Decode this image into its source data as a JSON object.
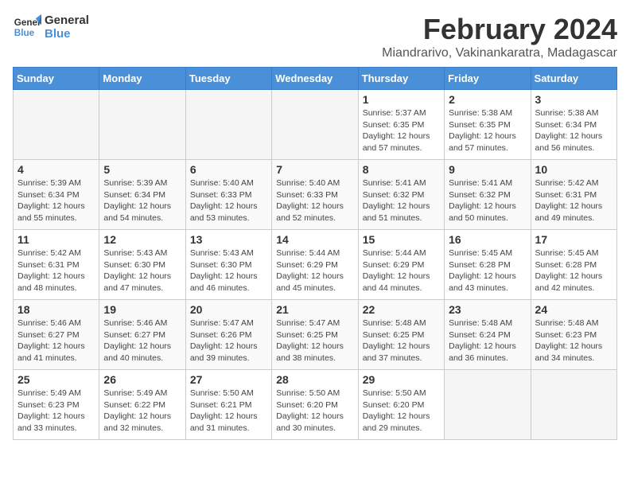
{
  "logo": {
    "line1": "General",
    "line2": "Blue"
  },
  "title": "February 2024",
  "location": "Miandrarivo, Vakinankaratra, Madagascar",
  "days_of_week": [
    "Sunday",
    "Monday",
    "Tuesday",
    "Wednesday",
    "Thursday",
    "Friday",
    "Saturday"
  ],
  "weeks": [
    [
      {
        "day": "",
        "info": ""
      },
      {
        "day": "",
        "info": ""
      },
      {
        "day": "",
        "info": ""
      },
      {
        "day": "",
        "info": ""
      },
      {
        "day": "1",
        "info": "Sunrise: 5:37 AM\nSunset: 6:35 PM\nDaylight: 12 hours\nand 57 minutes."
      },
      {
        "day": "2",
        "info": "Sunrise: 5:38 AM\nSunset: 6:35 PM\nDaylight: 12 hours\nand 57 minutes."
      },
      {
        "day": "3",
        "info": "Sunrise: 5:38 AM\nSunset: 6:34 PM\nDaylight: 12 hours\nand 56 minutes."
      }
    ],
    [
      {
        "day": "4",
        "info": "Sunrise: 5:39 AM\nSunset: 6:34 PM\nDaylight: 12 hours\nand 55 minutes."
      },
      {
        "day": "5",
        "info": "Sunrise: 5:39 AM\nSunset: 6:34 PM\nDaylight: 12 hours\nand 54 minutes."
      },
      {
        "day": "6",
        "info": "Sunrise: 5:40 AM\nSunset: 6:33 PM\nDaylight: 12 hours\nand 53 minutes."
      },
      {
        "day": "7",
        "info": "Sunrise: 5:40 AM\nSunset: 6:33 PM\nDaylight: 12 hours\nand 52 minutes."
      },
      {
        "day": "8",
        "info": "Sunrise: 5:41 AM\nSunset: 6:32 PM\nDaylight: 12 hours\nand 51 minutes."
      },
      {
        "day": "9",
        "info": "Sunrise: 5:41 AM\nSunset: 6:32 PM\nDaylight: 12 hours\nand 50 minutes."
      },
      {
        "day": "10",
        "info": "Sunrise: 5:42 AM\nSunset: 6:31 PM\nDaylight: 12 hours\nand 49 minutes."
      }
    ],
    [
      {
        "day": "11",
        "info": "Sunrise: 5:42 AM\nSunset: 6:31 PM\nDaylight: 12 hours\nand 48 minutes."
      },
      {
        "day": "12",
        "info": "Sunrise: 5:43 AM\nSunset: 6:30 PM\nDaylight: 12 hours\nand 47 minutes."
      },
      {
        "day": "13",
        "info": "Sunrise: 5:43 AM\nSunset: 6:30 PM\nDaylight: 12 hours\nand 46 minutes."
      },
      {
        "day": "14",
        "info": "Sunrise: 5:44 AM\nSunset: 6:29 PM\nDaylight: 12 hours\nand 45 minutes."
      },
      {
        "day": "15",
        "info": "Sunrise: 5:44 AM\nSunset: 6:29 PM\nDaylight: 12 hours\nand 44 minutes."
      },
      {
        "day": "16",
        "info": "Sunrise: 5:45 AM\nSunset: 6:28 PM\nDaylight: 12 hours\nand 43 minutes."
      },
      {
        "day": "17",
        "info": "Sunrise: 5:45 AM\nSunset: 6:28 PM\nDaylight: 12 hours\nand 42 minutes."
      }
    ],
    [
      {
        "day": "18",
        "info": "Sunrise: 5:46 AM\nSunset: 6:27 PM\nDaylight: 12 hours\nand 41 minutes."
      },
      {
        "day": "19",
        "info": "Sunrise: 5:46 AM\nSunset: 6:27 PM\nDaylight: 12 hours\nand 40 minutes."
      },
      {
        "day": "20",
        "info": "Sunrise: 5:47 AM\nSunset: 6:26 PM\nDaylight: 12 hours\nand 39 minutes."
      },
      {
        "day": "21",
        "info": "Sunrise: 5:47 AM\nSunset: 6:25 PM\nDaylight: 12 hours\nand 38 minutes."
      },
      {
        "day": "22",
        "info": "Sunrise: 5:48 AM\nSunset: 6:25 PM\nDaylight: 12 hours\nand 37 minutes."
      },
      {
        "day": "23",
        "info": "Sunrise: 5:48 AM\nSunset: 6:24 PM\nDaylight: 12 hours\nand 36 minutes."
      },
      {
        "day": "24",
        "info": "Sunrise: 5:48 AM\nSunset: 6:23 PM\nDaylight: 12 hours\nand 34 minutes."
      }
    ],
    [
      {
        "day": "25",
        "info": "Sunrise: 5:49 AM\nSunset: 6:23 PM\nDaylight: 12 hours\nand 33 minutes."
      },
      {
        "day": "26",
        "info": "Sunrise: 5:49 AM\nSunset: 6:22 PM\nDaylight: 12 hours\nand 32 minutes."
      },
      {
        "day": "27",
        "info": "Sunrise: 5:50 AM\nSunset: 6:21 PM\nDaylight: 12 hours\nand 31 minutes."
      },
      {
        "day": "28",
        "info": "Sunrise: 5:50 AM\nSunset: 6:20 PM\nDaylight: 12 hours\nand 30 minutes."
      },
      {
        "day": "29",
        "info": "Sunrise: 5:50 AM\nSunset: 6:20 PM\nDaylight: 12 hours\nand 29 minutes."
      },
      {
        "day": "",
        "info": ""
      },
      {
        "day": "",
        "info": ""
      }
    ]
  ]
}
